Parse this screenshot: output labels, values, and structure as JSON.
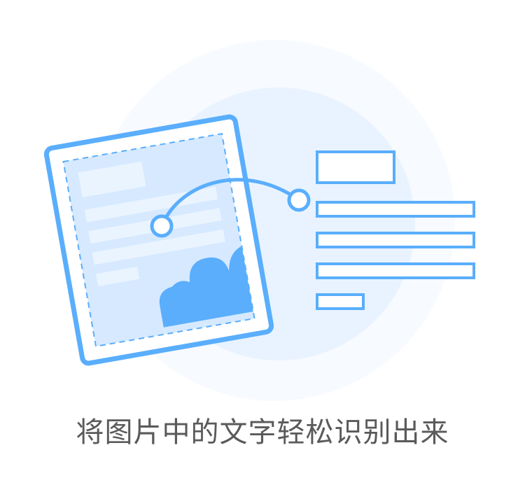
{
  "caption": "将图片中的文字轻松识别出来",
  "colors": {
    "background": "#ffffff",
    "outer_circle": "#f7faff",
    "inner_circle": "#e8f3ff",
    "accent": "#5aaefc",
    "page_fill": "#d6e9ff",
    "page_bars": "#eaf4ff",
    "caption_text": "#5a5a5a"
  },
  "icons": [
    "document-scan-illustration",
    "cloud-image-icon",
    "text-lines-icon"
  ]
}
